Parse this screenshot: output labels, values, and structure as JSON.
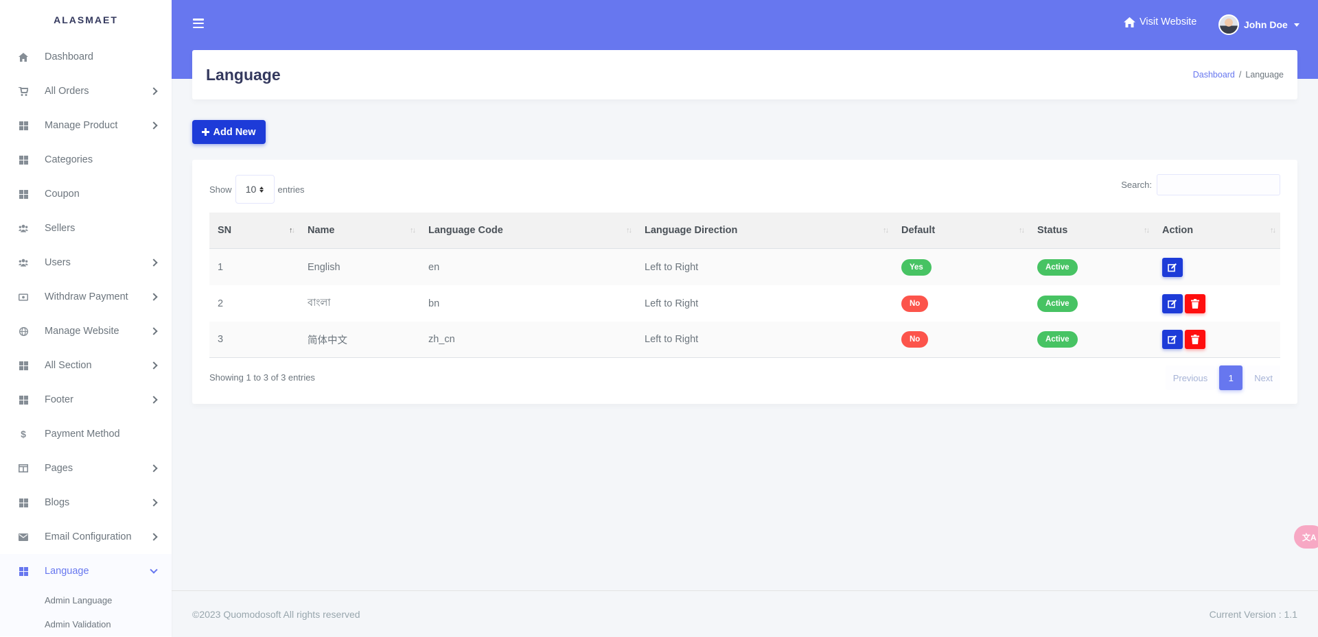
{
  "brand": "ALASMAET",
  "sidebar": {
    "items": [
      {
        "label": "Dashboard",
        "icon": "home-icon",
        "chevron": false
      },
      {
        "label": "All Orders",
        "icon": "cart-icon",
        "chevron": true
      },
      {
        "label": "Manage Product",
        "icon": "grid-icon",
        "chevron": true
      },
      {
        "label": "Categories",
        "icon": "grid-icon",
        "chevron": false
      },
      {
        "label": "Coupon",
        "icon": "grid-icon",
        "chevron": false
      },
      {
        "label": "Sellers",
        "icon": "users-icon",
        "chevron": false
      },
      {
        "label": "Users",
        "icon": "users-icon",
        "chevron": true
      },
      {
        "label": "Withdraw Payment",
        "icon": "money-icon",
        "chevron": true
      },
      {
        "label": "Manage Website",
        "icon": "globe-icon",
        "chevron": true
      },
      {
        "label": "All Section",
        "icon": "grid-icon",
        "chevron": true
      },
      {
        "label": "Footer",
        "icon": "grid-icon",
        "chevron": true
      },
      {
        "label": "Payment Method",
        "icon": "dollar-icon",
        "chevron": false
      },
      {
        "label": "Pages",
        "icon": "columns-icon",
        "chevron": true
      },
      {
        "label": "Blogs",
        "icon": "grid-icon",
        "chevron": true
      },
      {
        "label": "Email Configuration",
        "icon": "envelope-icon",
        "chevron": true
      },
      {
        "label": "Language",
        "icon": "grid-icon",
        "chevron": true,
        "active": true
      }
    ],
    "sub_items": [
      "Admin Language",
      "Admin Validation"
    ]
  },
  "header": {
    "visit_label": "Visit Website",
    "user_name": "John Doe"
  },
  "page": {
    "title": "Language",
    "breadcrumb": {
      "link": "Dashboard",
      "separator": "/",
      "current": "Language"
    },
    "add_label": "Add New"
  },
  "table": {
    "show_label": "Show",
    "entries_value": "10",
    "entries_label": "entries",
    "search_label": "Search:",
    "columns": [
      "SN",
      "Name",
      "Language Code",
      "Language Direction",
      "Default",
      "Status",
      "Action"
    ],
    "rows": [
      {
        "sn": "1",
        "name": "English",
        "code": "en",
        "direction": "Left to Right",
        "default": "Yes",
        "status": "Active",
        "deletable": false
      },
      {
        "sn": "2",
        "name": "বাংলা",
        "code": "bn",
        "direction": "Left to Right",
        "default": "No",
        "status": "Active",
        "deletable": true
      },
      {
        "sn": "3",
        "name": "简体中文",
        "code": "zh_cn",
        "direction": "Left to Right",
        "default": "No",
        "status": "Active",
        "deletable": true
      }
    ],
    "info": "Showing 1 to 3 of 3 entries",
    "pagination": {
      "previous": "Previous",
      "current": "1",
      "next": "Next"
    }
  },
  "footer": {
    "copyright": "©2023 Quomodosoft All rights reserved",
    "version": "Current Version : 1.1"
  },
  "colors": {
    "primary": "#6777ef",
    "button": "#1d3bd8",
    "danger": "#ff0e0e",
    "success": "#47c363",
    "badge_red": "#fc544b"
  }
}
